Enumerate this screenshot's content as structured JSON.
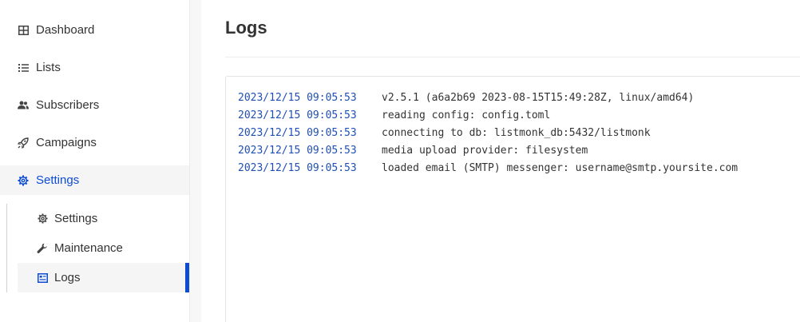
{
  "sidebar": {
    "items": [
      {
        "label": "Dashboard",
        "icon": "dashboard-icon"
      },
      {
        "label": "Lists",
        "icon": "list-icon"
      },
      {
        "label": "Subscribers",
        "icon": "users-icon"
      },
      {
        "label": "Campaigns",
        "icon": "rocket-icon"
      },
      {
        "label": "Settings",
        "icon": "gear-icon",
        "active": true
      }
    ],
    "sub_items": [
      {
        "label": "Settings",
        "icon": "gear-icon"
      },
      {
        "label": "Maintenance",
        "icon": "wrench-icon"
      },
      {
        "label": "Logs",
        "icon": "logs-icon",
        "active": true
      }
    ]
  },
  "main": {
    "title": "Logs",
    "logs": [
      {
        "timestamp": "2023/12/15 09:05:53",
        "message": "v2.5.1 (a6a2b69 2023-08-15T15:49:28Z, linux/amd64)"
      },
      {
        "timestamp": "2023/12/15 09:05:53",
        "message": "reading config: config.toml"
      },
      {
        "timestamp": "2023/12/15 09:05:53",
        "message": "connecting to db: listmonk_db:5432/listmonk"
      },
      {
        "timestamp": "2023/12/15 09:05:53",
        "message": "media upload provider: filesystem"
      },
      {
        "timestamp": "2023/12/15 09:05:53",
        "message": "loaded email (SMTP) messenger: username@smtp.yoursite.com"
      }
    ]
  },
  "colors": {
    "accent": "#0d4cd2",
    "timestamp": "#1f4fb4"
  }
}
